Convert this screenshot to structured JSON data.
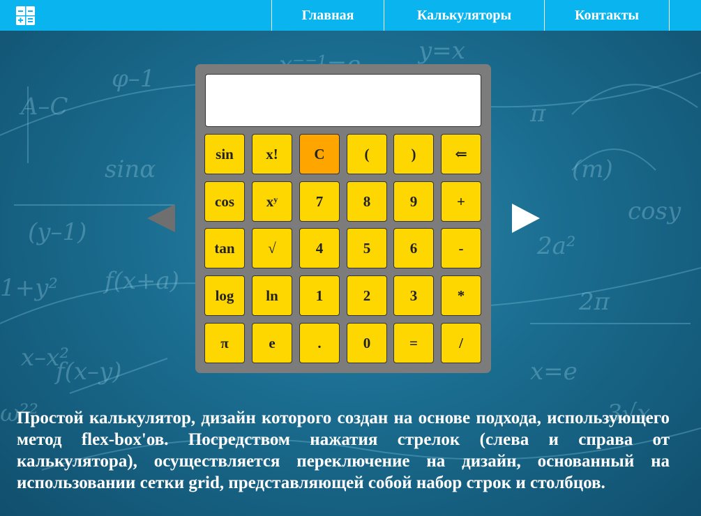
{
  "nav": {
    "items": [
      {
        "label": "Главная"
      },
      {
        "label": "Калькуляторы"
      },
      {
        "label": "Контакты"
      }
    ]
  },
  "calculator": {
    "display_value": "",
    "keys": [
      [
        "sin",
        "x!",
        "C",
        "(",
        ")",
        "⇐"
      ],
      [
        "cos",
        "x^y",
        "7",
        "8",
        "9",
        "+"
      ],
      [
        "tan",
        "√",
        "4",
        "5",
        "6",
        "-"
      ],
      [
        "log",
        "ln",
        "1",
        "2",
        "3",
        "*"
      ],
      [
        "π",
        "e",
        ".",
        "0",
        "=",
        "/"
      ]
    ]
  },
  "description": "Простой калькулятор, дизайн которого создан на основе подхода, использующего метод flex-box'ов. Посредством нажатия стрелок (слева и справа от калькулятора), осуществляется переключение на дизайн, основанный на использовании сетки grid, представляющей собой набор строк и столбцов.",
  "colors": {
    "nav_bg": "#0ab4ef",
    "key_bg": "#ffd700",
    "clear_key_bg": "#ffa500",
    "calc_body": "#7c7c7c"
  }
}
